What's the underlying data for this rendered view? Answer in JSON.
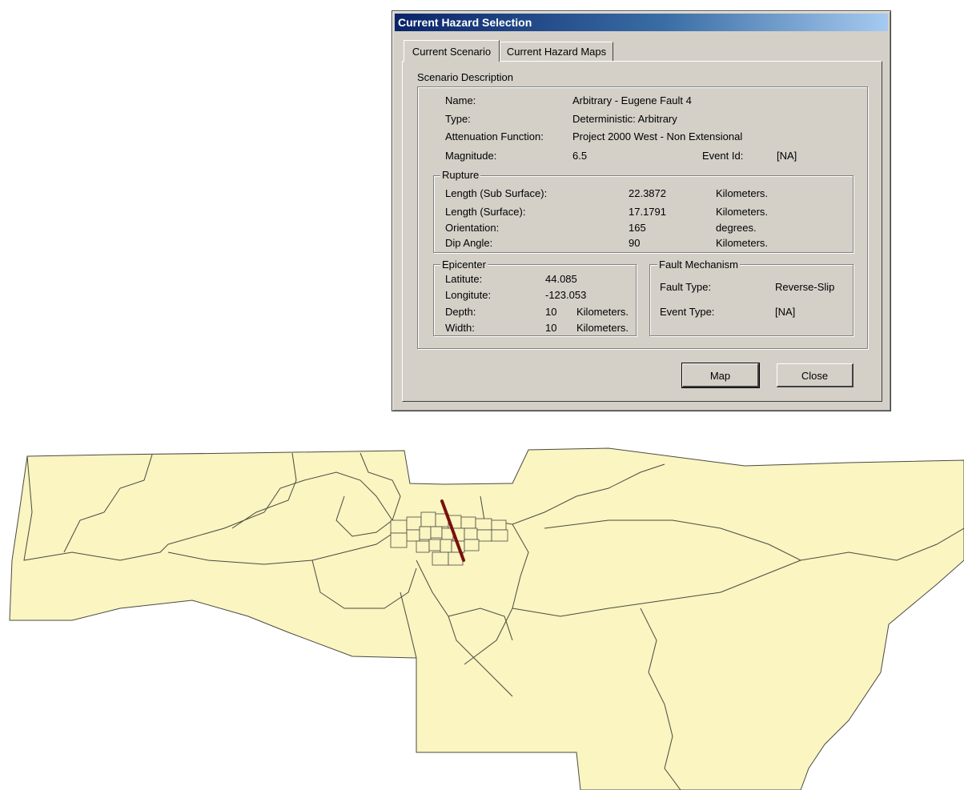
{
  "dialog": {
    "title": "Current Hazard Selection",
    "tabs": [
      "Current Scenario",
      "Current Hazard Maps"
    ],
    "scenario_group": "Scenario Description",
    "name_label": "Name:",
    "name_value": "Arbitrary - Eugene Fault 4",
    "type_label": "Type:",
    "type_value": "Deterministic: Arbitrary",
    "attenuation_label": "Attenuation Function:",
    "attenuation_value": "Project 2000 West - Non Extensional",
    "magnitude_label": "Magnitude:",
    "magnitude_value": "6.5",
    "event_id_label": "Event Id:",
    "event_id_value": "[NA]",
    "rupture": {
      "title": "Rupture",
      "rows": [
        {
          "label": "Length (Sub Surface):",
          "value": "22.3872",
          "unit": "Kilometers."
        },
        {
          "label": "Length (Surface):",
          "value": "17.1791",
          "unit": "Kilometers."
        },
        {
          "label": "Orientation:",
          "value": "165",
          "unit": "degrees."
        },
        {
          "label": "Dip Angle:",
          "value": "90",
          "unit": "Kilometers."
        }
      ]
    },
    "epicenter": {
      "title": "Epicenter",
      "rows": [
        {
          "label": "Latitute:",
          "value": "44.085",
          "unit": ""
        },
        {
          "label": "Longitute:",
          "value": "-123.053",
          "unit": ""
        },
        {
          "label": "Depth:",
          "value": "10",
          "unit": "Kilometers."
        },
        {
          "label": "Width:",
          "value": "10",
          "unit": "Kilometers."
        }
      ]
    },
    "fault_mechanism": {
      "title": "Fault Mechanism",
      "fault_type_label": "Fault Type:",
      "fault_type_value": "Reverse-Slip",
      "event_type_label": "Event Type:",
      "event_type_value": "[NA]"
    },
    "buttons": {
      "map": "Map",
      "close": "Close"
    }
  },
  "colors": {
    "map_fill": "#faf5c1",
    "map_stroke": "#4a4a40",
    "fault_line": "#7a0f0f"
  }
}
